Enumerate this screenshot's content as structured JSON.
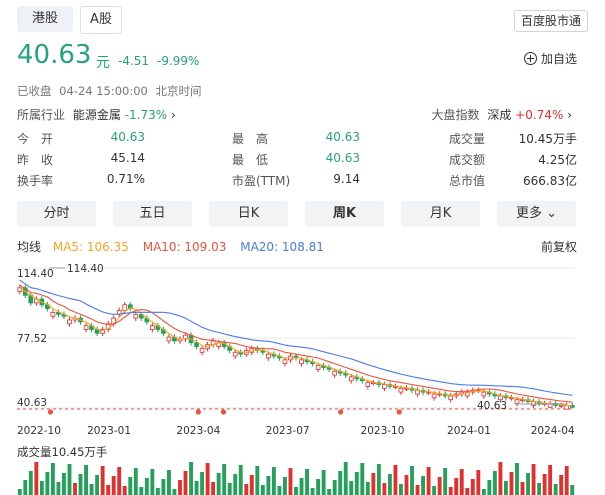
{
  "tabs": [
    {
      "label": "港股",
      "active": false
    },
    {
      "label": "A股",
      "active": true
    }
  ],
  "top_button": "百度股市通",
  "quote": {
    "price": "40.63",
    "unit": "元",
    "change": "-4.51",
    "change_pct": "-9.99%",
    "status": "已收盘",
    "datetime": "04-24 15:00:00",
    "timezone": "北京时间",
    "add_watch": "加自选",
    "industry_label": "所属行业",
    "industry": "能源金属",
    "industry_change": "-1.73%",
    "index_label": "大盘指数",
    "index_name": "深成",
    "index_change": "+0.74%"
  },
  "stats": {
    "col1": [
      {
        "label": "今　开",
        "value": "40.63",
        "color": "#27a27a"
      },
      {
        "label": "昨　收",
        "value": "45.14",
        "color": "#333333"
      },
      {
        "label": "换手率",
        "value": "0.71%",
        "color": "#333333"
      }
    ],
    "col2": [
      {
        "label": "最　高",
        "value": "40.63",
        "color": "#27a27a"
      },
      {
        "label": "最　低",
        "value": "40.63",
        "color": "#27a27a"
      },
      {
        "label": "市盈(TTM)",
        "value": "9.14",
        "color": "#333333"
      }
    ],
    "col3": [
      {
        "label": "成交量",
        "value": "10.45万手",
        "color": "#333333"
      },
      {
        "label": "成交额",
        "value": "4.25亿",
        "color": "#333333"
      },
      {
        "label": "总市值",
        "value": "666.83亿",
        "color": "#333333"
      }
    ]
  },
  "periods": [
    {
      "label": "分时",
      "active": false
    },
    {
      "label": "五日",
      "active": false
    },
    {
      "label": "日K",
      "active": false
    },
    {
      "label": "周K",
      "active": true
    },
    {
      "label": "月K",
      "active": false
    },
    {
      "label": "更多",
      "active": false
    }
  ],
  "ma": {
    "title": "均线",
    "ma5": "MA5: 106.35",
    "ma10": "MA10: 109.03",
    "ma20": "MA20: 108.81",
    "fuquan": "前复权"
  },
  "colors": {
    "up": "#e03030",
    "down": "#23a05a",
    "ma5": "#f5a623",
    "ma10": "#e8553a",
    "ma20": "#4a7be8",
    "accent": "#27a27a"
  },
  "chart_data": {
    "type": "candlestick",
    "y_ticks": [
      "114.40",
      "77.52",
      "40.63"
    ],
    "high_label": "114.40",
    "low_label": "40.63",
    "x_ticks": [
      "2022-10",
      "2023-01",
      "2023-04",
      "2023-07",
      "2023-10",
      "2024-01",
      "2024-04"
    ],
    "ylim": [
      40.63,
      114.4
    ],
    "close": [
      104,
      100,
      96,
      98,
      95,
      93,
      91,
      90,
      89,
      87,
      88,
      86,
      84,
      82,
      80,
      82,
      85,
      88,
      92,
      95,
      93,
      90,
      88,
      86,
      84,
      82,
      80,
      78,
      76,
      77,
      79,
      75,
      73,
      72,
      74,
      76,
      75,
      73,
      71,
      70,
      69,
      71,
      72,
      71,
      70,
      69,
      68,
      67,
      66,
      68,
      67,
      66,
      65,
      64,
      63,
      62,
      61,
      60,
      59,
      58,
      57,
      56,
      55,
      54,
      54,
      53,
      53,
      52,
      52,
      51,
      51,
      50,
      50,
      49,
      49,
      48,
      48,
      47,
      47,
      48,
      49,
      49,
      50,
      50,
      49,
      48,
      47,
      47,
      46,
      46,
      45,
      45,
      44,
      44,
      43,
      43,
      43,
      42,
      42,
      42,
      41
    ],
    "volume_label": "成交量10.45万手"
  }
}
